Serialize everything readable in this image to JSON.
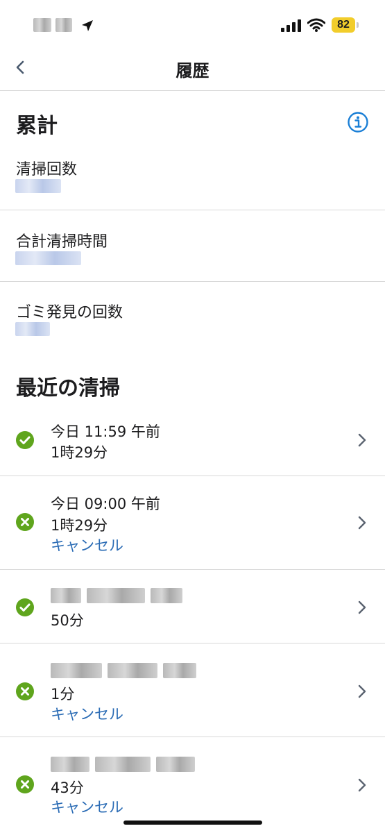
{
  "status_bar": {
    "battery_level": "82",
    "battery_color": "#f2cd2b"
  },
  "nav": {
    "title": "履歴"
  },
  "totals": {
    "title": "累計",
    "items": [
      {
        "label": "清掃回数"
      },
      {
        "label": "合計清掃時間"
      },
      {
        "label": "ゴミ発見の回数"
      }
    ]
  },
  "recent": {
    "title": "最近の清掃",
    "items": [
      {
        "status": "completed",
        "date": "今日 11:59 午前",
        "duration": "1時29分",
        "note": ""
      },
      {
        "status": "cancelled",
        "date": "今日 09:00 午前",
        "duration": "1時29分",
        "note": "キャンセル"
      },
      {
        "status": "completed",
        "date": "",
        "duration": "50分",
        "note": ""
      },
      {
        "status": "cancelled",
        "date": "",
        "duration": "1分",
        "note": "キャンセル"
      },
      {
        "status": "cancelled",
        "date": "",
        "duration": "43分",
        "note": "キャンセル"
      }
    ]
  },
  "colors": {
    "accent_blue": "#2b6cb5",
    "status_green": "#5fa51d",
    "info_blue": "#1a7fd6"
  }
}
